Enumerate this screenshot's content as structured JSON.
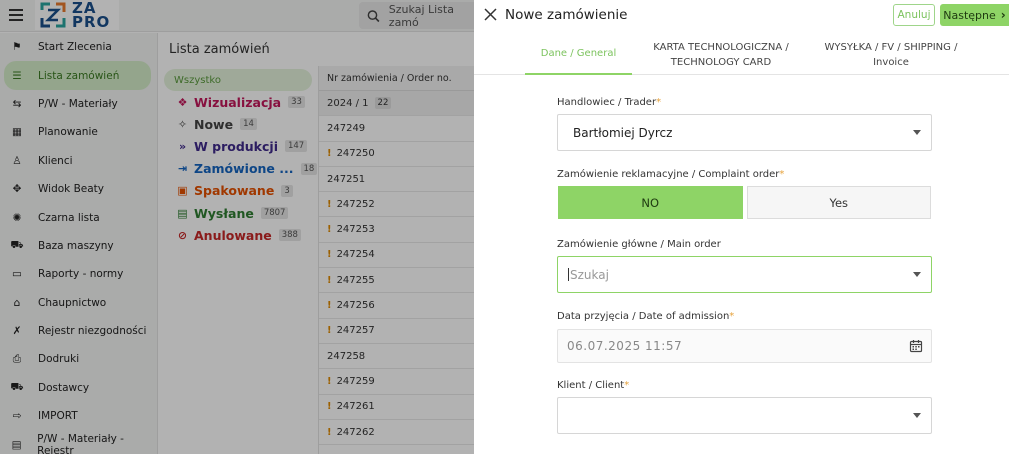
{
  "app": {
    "logo_text_top": "ZA",
    "logo_text_bottom": "PRO",
    "search_placeholder": "Szukaj Lista zamó"
  },
  "sidebar": {
    "items": [
      {
        "label": "Start Zlecenia",
        "icon": "flag-icon"
      },
      {
        "label": "Lista zamówień",
        "icon": "list-icon"
      },
      {
        "label": "P/W - Materiały",
        "icon": "materials-icon"
      },
      {
        "label": "Planowanie",
        "icon": "calendar-check-icon"
      },
      {
        "label": "Klienci",
        "icon": "person-icon"
      },
      {
        "label": "Widok Beaty",
        "icon": "puzzle-icon"
      },
      {
        "label": "Czarna lista",
        "icon": "virus-icon"
      },
      {
        "label": "Baza maszyny",
        "icon": "machine-icon"
      },
      {
        "label": "Raporty - normy",
        "icon": "report-icon"
      },
      {
        "label": "Chaupnictwo",
        "icon": "home-icon"
      },
      {
        "label": "Rejestr niezgodności",
        "icon": "tools-icon"
      },
      {
        "label": "Dodruki",
        "icon": "printer-icon"
      },
      {
        "label": "Dostawcy",
        "icon": "truck-icon"
      },
      {
        "label": "IMPORT",
        "icon": "import-icon"
      },
      {
        "label": "P/W - Materiały - Rejestr",
        "icon": "register-icon"
      }
    ]
  },
  "main": {
    "title": "Lista zamówień",
    "filter_all": "Wszystko",
    "filters": [
      {
        "label": "Wizualizacja",
        "count": "33",
        "color": "#c2185b",
        "glyph": "❖",
        "icon": "visualization-icon"
      },
      {
        "label": "Nowe",
        "count": "14",
        "color": "#444444",
        "glyph": "✧",
        "icon": "sparkle-icon"
      },
      {
        "label": "W produkcji",
        "count": "147",
        "color": "#3f2a8c",
        "glyph": "»",
        "icon": "fast-forward-icon"
      },
      {
        "label": "Zamówione ...",
        "count": "18",
        "color": "#1565c0",
        "glyph": "⇥",
        "icon": "arrow-in-icon"
      },
      {
        "label": "Spakowane",
        "count": "3",
        "color": "#e65100",
        "glyph": "▣",
        "icon": "box-icon"
      },
      {
        "label": "Wysłane",
        "count": "7807",
        "color": "#2e7d32",
        "glyph": "▤",
        "icon": "shipped-icon"
      },
      {
        "label": "Anulowane",
        "count": "388",
        "color": "#c62828",
        "glyph": "⊘",
        "icon": "cancel-circle-icon"
      }
    ],
    "table_header": "Nr zamówienia / Order no.",
    "rows": [
      {
        "value": "2024 / 1",
        "badge": "22",
        "group": true,
        "warn": false
      },
      {
        "value": "247249",
        "warn": false
      },
      {
        "value": "247250",
        "warn": true
      },
      {
        "value": "247251",
        "warn": false
      },
      {
        "value": "247252",
        "warn": true
      },
      {
        "value": "247253",
        "warn": true
      },
      {
        "value": "247254",
        "warn": true
      },
      {
        "value": "247255",
        "warn": true
      },
      {
        "value": "247256",
        "warn": true
      },
      {
        "value": "247257",
        "warn": true
      },
      {
        "value": "247258",
        "warn": false
      },
      {
        "value": "247259",
        "warn": true
      },
      {
        "value": "247261",
        "warn": true
      },
      {
        "value": "247262",
        "warn": true
      }
    ]
  },
  "drawer": {
    "title": "Nowe zamówienie",
    "cancel_label": "Anuluj",
    "next_label": "Następne",
    "tabs": {
      "general": "Dane / General",
      "tech_line1": "KARTA TECHNOLOGICZNA /",
      "tech_line2": "TECHNOLOGY CARD",
      "shipping": "WYSYŁKA / FV / SHIPPING / Invoice"
    },
    "form": {
      "trader_label": "Handlowiec / Trader",
      "trader_value": "Bartłomiej Dyrcz",
      "complaint_label": "Zamówienie reklamacyjne / Complaint order",
      "complaint_no": "NO",
      "complaint_yes": "Yes",
      "main_order_label": "Zamówienie główne / Main order",
      "main_order_placeholder": "Szukaj",
      "date_label": "Data przyjęcia / Date of admission",
      "date_value": "06.07.2025 11:57",
      "client_label": "Klient / Client",
      "client_value": ""
    },
    "colors": {
      "accent": "#8ed466",
      "required": "#e6a23c"
    }
  }
}
